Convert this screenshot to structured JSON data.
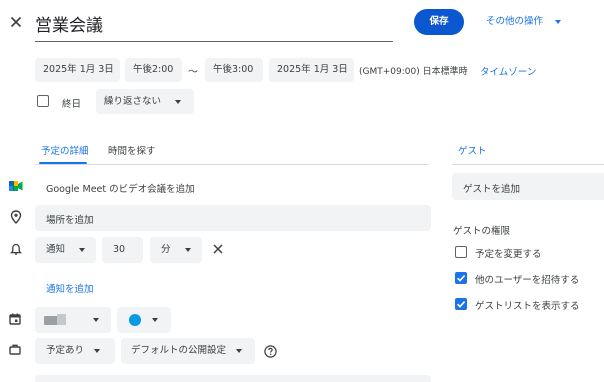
{
  "header": {
    "title": "営業会議",
    "save_label": "保存",
    "more_actions_label": "その他の操作"
  },
  "datetime": {
    "start_date": "2025年 1月 3日",
    "start_time": "午後2:00",
    "separator": "〜",
    "end_time": "午後3:00",
    "end_date": "2025年 1月 3日",
    "timezone": "(GMT+09:00) 日本標準時",
    "timezone_link": "タイムゾーン",
    "all_day_label": "終日",
    "all_day_checked": false,
    "repeat_label": "繰り返さない"
  },
  "tabs": {
    "details": "予定の詳細",
    "find_time": "時間を探す",
    "active": "details"
  },
  "details": {
    "meet_label": "Google Meet のビデオ会議を追加",
    "location_placeholder": "場所を追加",
    "notification": {
      "type": "通知",
      "value": "30",
      "unit": "分"
    },
    "add_notification_label": "通知を追加",
    "calendar_color": "#039be5",
    "busy_status": "予定あり",
    "visibility": "デフォルトの公開設定"
  },
  "guests": {
    "tab_label": "ゲスト",
    "add_placeholder": "ゲストを追加",
    "permissions_title": "ゲストの権限",
    "permissions": [
      {
        "label": "予定を変更する",
        "checked": false
      },
      {
        "label": "他のユーザーを招待する",
        "checked": true
      },
      {
        "label": "ゲストリストを表示する",
        "checked": true
      }
    ]
  },
  "colors": {
    "accent": "#0b57d0",
    "link": "#1a73e8",
    "chip_bg": "#f1f3f4"
  }
}
